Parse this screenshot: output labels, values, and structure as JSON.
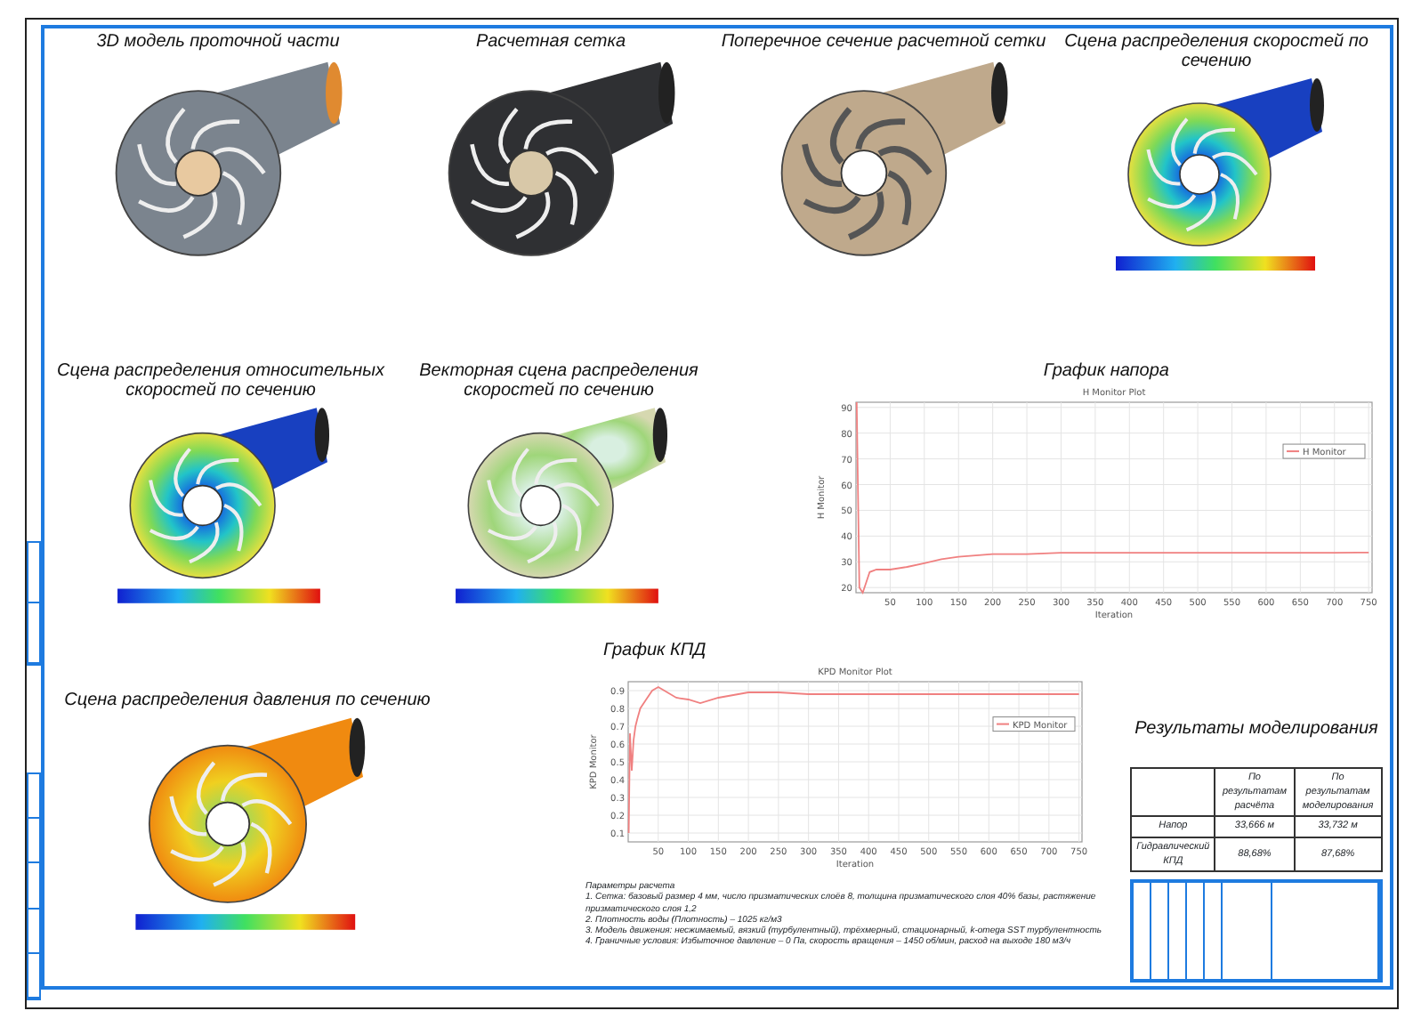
{
  "row_1": [
    {
      "caption": "3D модель проточной части",
      "kind": "model"
    },
    {
      "caption": "Расчетная сетка",
      "kind": "mesh"
    },
    {
      "caption": "Поперечное сечение расчетной сетки",
      "kind": "section"
    },
    {
      "caption": "Сцена распределения скоростей по сечению",
      "kind": "velocity"
    }
  ],
  "row_2": [
    {
      "caption": "Сцена распределения относительных скоростей по сечению",
      "kind": "relative"
    },
    {
      "caption": "Векторная сцена распределения скоростей по сечению",
      "kind": "vector"
    }
  ],
  "head_chart": {
    "caption": "График напора",
    "chart_data": {
      "type": "line",
      "title": "H Monitor Plot",
      "xlabel": "Iteration",
      "ylabel": "H Monitor",
      "x": [
        1,
        5,
        10,
        20,
        30,
        50,
        75,
        100,
        125,
        150,
        200,
        250,
        300,
        400,
        500,
        600,
        700,
        750
      ],
      "series": [
        {
          "name": "H Monitor",
          "color": "#f08080",
          "values": [
            92,
            20,
            18,
            26,
            27,
            27,
            28,
            29.5,
            31,
            32,
            33,
            33,
            33.5,
            33.5,
            33.5,
            33.5,
            33.5,
            33.6
          ]
        }
      ],
      "xlim": [
        0,
        755
      ],
      "ylim": [
        18,
        92
      ],
      "xticks": [
        50,
        100,
        150,
        200,
        250,
        300,
        350,
        400,
        450,
        500,
        550,
        600,
        650,
        700,
        750
      ],
      "yticks": [
        20,
        30,
        40,
        50,
        60,
        70,
        80,
        90
      ],
      "grid": true
    }
  },
  "pressure_scene": {
    "caption": "Сцена распределения давления по сечению",
    "kind": "pressure"
  },
  "efficiency_chart": {
    "caption": "График КПД",
    "chart_data": {
      "type": "line",
      "title": "KPD Monitor Plot",
      "xlabel": "Iteration",
      "ylabel": "KPD Monitor",
      "x": [
        1,
        3,
        6,
        9,
        12,
        15,
        20,
        30,
        40,
        50,
        60,
        80,
        100,
        120,
        150,
        200,
        250,
        300,
        400,
        500,
        600,
        700,
        750
      ],
      "series": [
        {
          "name": "KPD Monitor",
          "color": "#f08080",
          "values": [
            0.1,
            0.66,
            0.45,
            0.62,
            0.7,
            0.74,
            0.8,
            0.85,
            0.9,
            0.92,
            0.9,
            0.86,
            0.85,
            0.83,
            0.86,
            0.89,
            0.89,
            0.88,
            0.88,
            0.88,
            0.88,
            0.88,
            0.88
          ]
        }
      ],
      "xlim": [
        0,
        755
      ],
      "ylim": [
        0.05,
        0.95
      ],
      "xticks": [
        50,
        100,
        150,
        200,
        250,
        300,
        350,
        400,
        450,
        500,
        550,
        600,
        650,
        700,
        750
      ],
      "yticks": [
        0.1,
        0.2,
        0.3,
        0.4,
        0.5,
        0.6,
        0.7,
        0.8,
        0.9
      ],
      "grid": true
    }
  },
  "calculation_notes": {
    "title": "Параметры расчета",
    "lines": [
      "1. Сетка: базовый размер 4 мм, число призматических слоёв 8, толщина призматического слоя 40% базы, растяжение призматического слоя 1,2",
      "2. Плотность воды (Плотность) – 1025 кг/м3",
      "3. Модель движения: несжимаемый, вязкий (турбулентный), трёхмерный, стационарный, k-omega SST турбулентность",
      "4. Граничные условия: Избыточное давление – 0 Па, скорость вращения – 1450 об/мин, расход на выходе 180 м3/ч"
    ]
  },
  "results": {
    "caption": "Результаты моделирования",
    "columns": [
      "По результатам расчёта",
      "По результатам моделирования"
    ],
    "rows": [
      {
        "label": "Напор",
        "values": [
          "33,666 м",
          "33,732 м"
        ]
      },
      {
        "label": "Гидравлический КПД",
        "values": [
          "88,68%",
          "87,68%"
        ]
      }
    ]
  }
}
